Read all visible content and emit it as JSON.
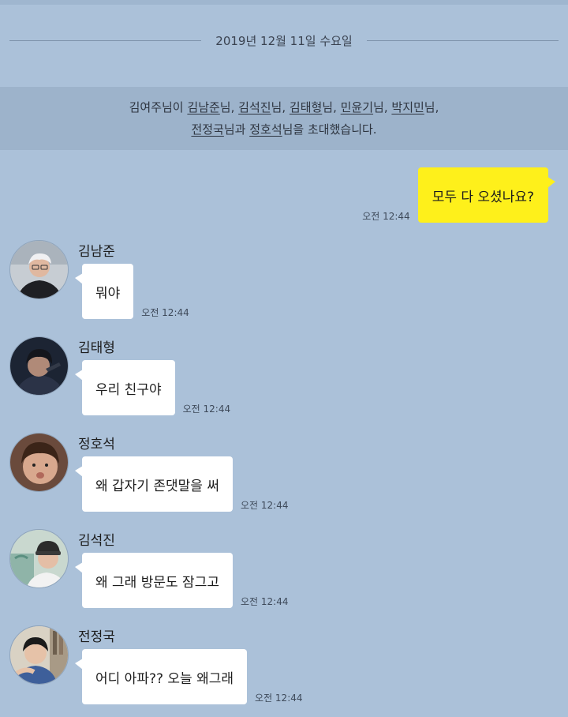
{
  "date_divider": "2019년 12월 11일 수요일",
  "invite": {
    "line1": {
      "prefix": "김여주님이 ",
      "names": [
        "김남준",
        "김석진",
        "김태형",
        "민윤기",
        "박지민"
      ],
      "suffix": "님,",
      "sep": "님, "
    },
    "line2": {
      "name1": "전정국",
      "mid": "님과 ",
      "name2": "정호석",
      "end": "님을 초대했습니다."
    }
  },
  "my_message": {
    "text": "모두 다 오셨나요?",
    "time": "오전 12:44",
    "bubble_color": "#fef01b"
  },
  "messages": [
    {
      "sender": "김남준",
      "text": "뭐야",
      "time": "오전 12:44",
      "avatar": "avatar-kim-namjoon"
    },
    {
      "sender": "김태형",
      "text": "우리 친구야",
      "time": "오전 12:44",
      "avatar": "avatar-kim-taehyung"
    },
    {
      "sender": "정호석",
      "text": "왜 갑자기 존댓말을 써",
      "time": "오전 12:44",
      "avatar": "avatar-jung-hoseok"
    },
    {
      "sender": "김석진",
      "text": "왜 그래 방문도 잠그고",
      "time": "오전 12:44",
      "avatar": "avatar-kim-seokjin"
    },
    {
      "sender": "전정국",
      "text": "어디 아파?? 오늘 왜그래",
      "time": "오전 12:44",
      "avatar": "avatar-jeon-jungkook"
    }
  ],
  "colors": {
    "background": "#abc1d9",
    "invite_band": "#9db3cb",
    "bubble_other": "#ffffff"
  }
}
